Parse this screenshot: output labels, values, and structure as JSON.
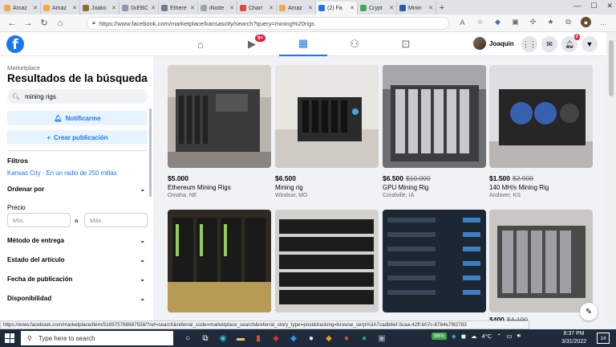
{
  "browser": {
    "tabs": [
      {
        "label": "Amaz",
        "color": "#f3a847"
      },
      {
        "label": "Amaz",
        "color": "#f3a847"
      },
      {
        "label": "Joako",
        "color": "#8c6a3e"
      },
      {
        "label": "0xEBC",
        "color": "#8e99a8"
      },
      {
        "label": "Ethere",
        "color": "#6d7b8a"
      },
      {
        "label": "iNode",
        "color": "#9ca3ad"
      },
      {
        "label": "Charr",
        "color": "#e04a3f"
      },
      {
        "label": "Amaz",
        "color": "#f3a847"
      },
      {
        "label": "(2) Fa",
        "color": "#1877f2"
      },
      {
        "label": "Crypt",
        "color": "#41a85f"
      },
      {
        "label": "Minin",
        "color": "#2b5aa8"
      }
    ],
    "url": "https://www.facebook.com/marketplace/kansascity/search?query=mining%20rigs",
    "status_url": "https://www.facebook.com/marketplace/item/516975786687558/?ref=search&referral_code=marketplace_search&referral_story_type=post&tracking=browse_serp%3A7cadb6ef-5caa-42ff-b07c-8764e7f82783"
  },
  "header": {
    "logo": "f",
    "video_badge": "9+",
    "profile_name": "Joaquin",
    "notifications_badge": "2",
    "active_color": "#1877f2"
  },
  "sidebar": {
    "breadcrumb": "Marketplace",
    "title": "Resultados de la búsqueda",
    "search_value": "mining rigs",
    "notify_label": "Notificarme",
    "create_label": "Crear publicación",
    "filters_heading": "Filtros",
    "location": "Kansas City · En un radio de 250 millas",
    "sort_label": "Ordenar por",
    "price_heading": "Precio",
    "price_min_placeholder": "Mín.",
    "price_separator": "a",
    "price_max_placeholder": "Máx.",
    "delivery_label": "Método de entrega",
    "condition_label": "Estado del artículo",
    "date_label": "Fecha de publicación",
    "availability_label": "Disponibilidad"
  },
  "listings": [
    {
      "price": "$5.000",
      "old_price": "",
      "title": "Ethereum Mining Rigs",
      "location": "Omaha, NE"
    },
    {
      "price": "$6.500",
      "old_price": "",
      "title": "Mining rig",
      "location": "Windsor, MO"
    },
    {
      "price": "$6.500",
      "old_price": "$10.000",
      "title": "GPU Mining Rig",
      "location": "Coralville, IA"
    },
    {
      "price": "$1.500",
      "old_price": "$2.900",
      "title": "140 MH/s Mining Rig",
      "location": "Andover, KS"
    },
    {
      "price": "",
      "old_price": "",
      "title": "",
      "location": ""
    },
    {
      "price": "",
      "old_price": "",
      "title": "",
      "location": ""
    },
    {
      "price": "",
      "old_price": "",
      "title": "",
      "location": ""
    },
    {
      "price": "$400",
      "old_price": "$4.100",
      "title": "",
      "location": ""
    }
  ],
  "taskbar": {
    "search_placeholder": "Type here to search",
    "battery": "98%",
    "temperature": "4°C",
    "time": "8:37 PM",
    "date": "3/31/2022",
    "notifications": "14"
  }
}
